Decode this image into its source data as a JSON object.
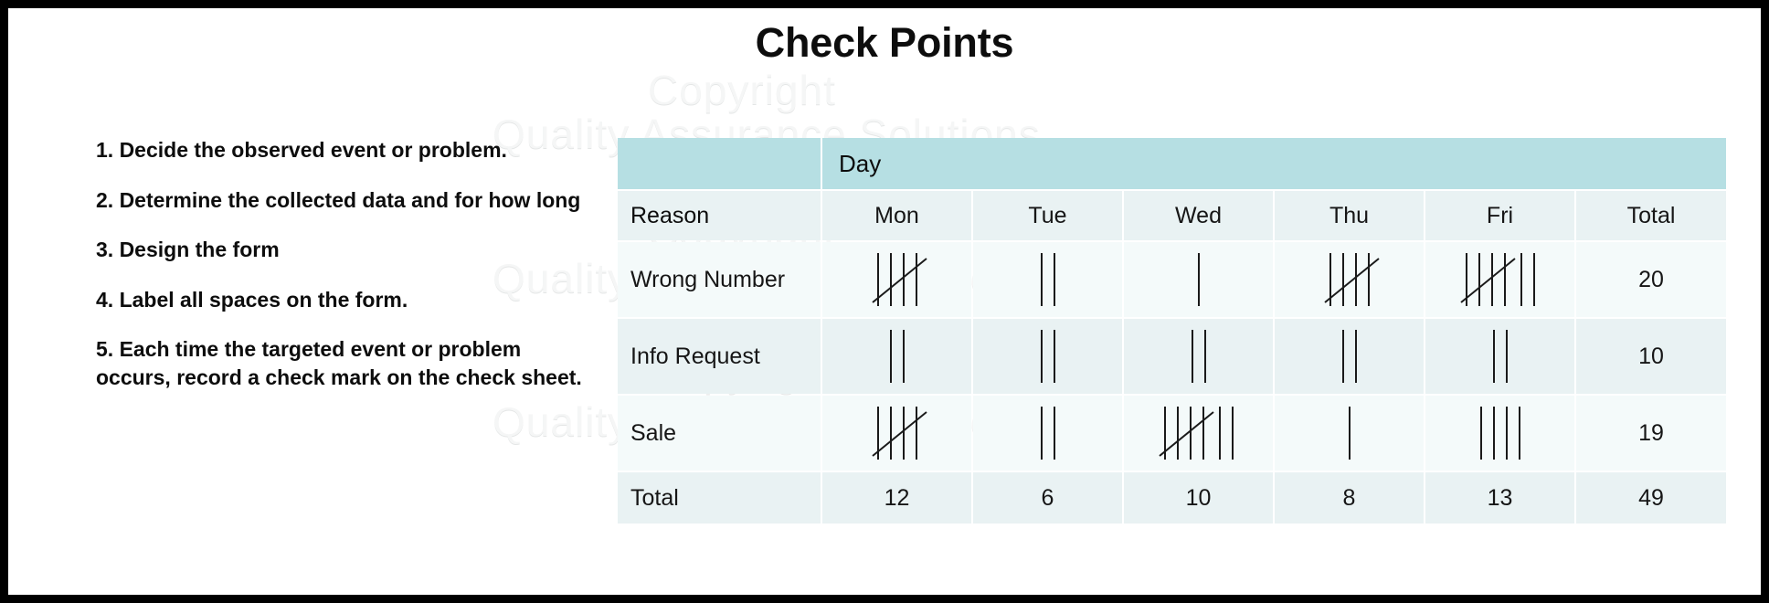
{
  "title": "Check Points",
  "watermark": {
    "line1": "Copyright",
    "line2": "Quality Assurance Solutions"
  },
  "steps": [
    "1. Decide the observed event or problem.",
    "2. Determine the collected data and for how long",
    "3. Design the form",
    "4. Label all spaces on the form.",
    "5. Each time the targeted event or problem occurs, record a check mark on the check sheet."
  ],
  "colors": {
    "day_band": "#b6dfe3",
    "header_row": "#e9f2f3",
    "row_light": "#f4fafa",
    "row_tint": "#e9f2f3",
    "frame": "#000000",
    "text": "#161616"
  },
  "table": {
    "group_header": "Day",
    "columns": [
      "Reason",
      "Mon",
      "Tue",
      "Wed",
      "Thu",
      "Fri",
      "Total"
    ],
    "rows": [
      {
        "reason": "Wrong Number",
        "tallies": [
          5,
          2,
          1,
          5,
          7
        ],
        "total": "20"
      },
      {
        "reason": "Info Request",
        "tallies": [
          2,
          2,
          2,
          2,
          2
        ],
        "total": "10"
      },
      {
        "reason": "Sale",
        "tallies": [
          5,
          2,
          7,
          1,
          4
        ],
        "total": "19"
      }
    ],
    "total_row": {
      "label": "Total",
      "values": [
        "12",
        "6",
        "10",
        "8",
        "13"
      ],
      "grand_total": "49"
    }
  }
}
